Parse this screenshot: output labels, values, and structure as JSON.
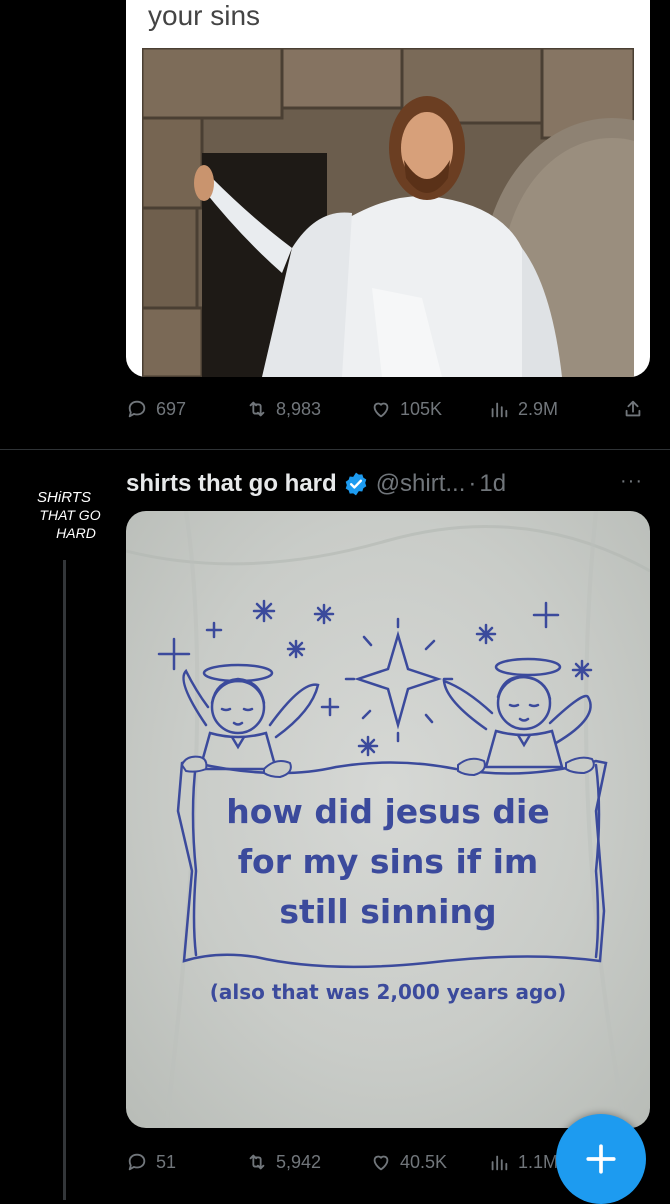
{
  "post1": {
    "meme_caption": "your sins",
    "actions": {
      "replies": "697",
      "reposts": "8,983",
      "likes": "105K",
      "views": "2.9M"
    }
  },
  "post2": {
    "author_name": "shirts that go hard",
    "handle": "@shirt...",
    "separator": "·",
    "time": "1d",
    "avatar_text": [
      "SHiRTS",
      "THAT GO",
      "HARD"
    ],
    "shirt_text": {
      "line1": "how did jesus die",
      "line2": "for my sins if im",
      "line3": "still sinning",
      "footnote": "(also that was 2,000 years ago)"
    },
    "actions": {
      "replies": "51",
      "reposts": "5,942",
      "likes": "40.5K",
      "views": "1.1M"
    }
  },
  "more_menu": "···",
  "colors": {
    "background": "#000000",
    "muted_text": "#71767b",
    "primary_text": "#e7e9ea",
    "accent": "#1d9bf0",
    "divider": "#2f3336",
    "shirt_print": "#3b4a9c"
  },
  "icons": [
    "reply-icon",
    "repost-icon",
    "like-icon",
    "views-icon",
    "share-icon",
    "verified-badge-icon",
    "more-icon",
    "compose-plus-icon"
  ]
}
